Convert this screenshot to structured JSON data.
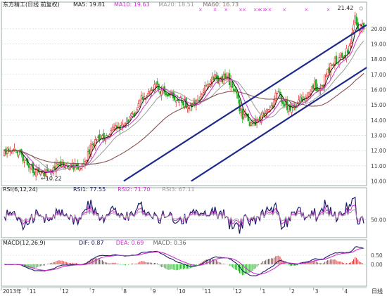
{
  "chart_data": [
    {
      "type": "candlestick",
      "title": "东方精工(日线 前复权)",
      "legend": [
        {
          "label": "MA5:",
          "value": "19.81",
          "color": "#1a1a1a"
        },
        {
          "label": "MA10:",
          "value": "19.63",
          "color": "#cc33cc"
        },
        {
          "label": "MA20:",
          "value": "18.51",
          "color": "#9a9a9a"
        },
        {
          "label": "MA60:",
          "value": "16.73",
          "color": "#8a6a6a"
        }
      ],
      "ylim": [
        9.7,
        21.75
      ],
      "yticks": [
        "20.00",
        "19.00",
        "18.00",
        "17.00",
        "16.00",
        "15.00",
        "14.00",
        "13.00",
        "12.00",
        "11.00",
        "10.00"
      ],
      "grid": true,
      "annotations": [
        {
          "text": "21.42",
          "kind": "high",
          "x": 0.968,
          "value": 21.42
        },
        {
          "text": "←10.22",
          "kind": "low",
          "x": 0.108,
          "value": 10.22
        }
      ],
      "trend_lines": [
        {
          "from": {
            "x": 0.335,
            "y": 10.0
          },
          "to": {
            "x": 1.0,
            "y": 20.25
          }
        },
        {
          "from": {
            "x": 0.52,
            "y": 10.0
          },
          "to": {
            "x": 1.0,
            "y": 17.45
          }
        }
      ],
      "path": [
        [
          0.0,
          11.8
        ],
        [
          0.03,
          12.3
        ],
        [
          0.05,
          11.5
        ],
        [
          0.07,
          11.0
        ],
        [
          0.1,
          10.35
        ],
        [
          0.13,
          10.8
        ],
        [
          0.16,
          11.2
        ],
        [
          0.19,
          11.0
        ],
        [
          0.21,
          10.9
        ],
        [
          0.225,
          11.3
        ],
        [
          0.245,
          12.4
        ],
        [
          0.26,
          12.8
        ],
        [
          0.28,
          13.0
        ],
        [
          0.3,
          13.4
        ],
        [
          0.32,
          13.6
        ],
        [
          0.34,
          13.9
        ],
        [
          0.36,
          14.4
        ],
        [
          0.38,
          15.4
        ],
        [
          0.4,
          15.6
        ],
        [
          0.42,
          16.2
        ],
        [
          0.44,
          15.9
        ],
        [
          0.46,
          15.6
        ],
        [
          0.48,
          15.3
        ],
        [
          0.5,
          15.2
        ],
        [
          0.52,
          14.8
        ],
        [
          0.54,
          15.1
        ],
        [
          0.56,
          16.3
        ],
        [
          0.58,
          16.9
        ],
        [
          0.6,
          16.6
        ],
        [
          0.62,
          16.8
        ],
        [
          0.64,
          16.1
        ],
        [
          0.66,
          14.4
        ],
        [
          0.68,
          13.9
        ],
        [
          0.7,
          13.8
        ],
        [
          0.72,
          14.3
        ],
        [
          0.74,
          14.7
        ],
        [
          0.76,
          15.8
        ],
        [
          0.78,
          15.0
        ],
        [
          0.8,
          14.8
        ],
        [
          0.82,
          15.2
        ],
        [
          0.84,
          15.6
        ],
        [
          0.86,
          16.3
        ],
        [
          0.88,
          16.0
        ],
        [
          0.9,
          17.2
        ],
        [
          0.92,
          17.9
        ],
        [
          0.94,
          18.0
        ],
        [
          0.955,
          18.6
        ],
        [
          0.965,
          19.2
        ],
        [
          0.975,
          21.0
        ],
        [
          0.985,
          19.8
        ],
        [
          0.995,
          20.1
        ]
      ],
      "ma_series": [
        {
          "name": "MA5",
          "color": "#1a1a1a",
          "lag": 4,
          "width": 1.0
        },
        {
          "name": "MA10",
          "color": "#cc33cc",
          "lag": 9,
          "width": 1.0
        },
        {
          "name": "MA20",
          "color": "#9a9a9a",
          "lag": 18,
          "width": 1.0
        },
        {
          "name": "MA60",
          "color": "#8a5050",
          "lag": 55,
          "width": 1.1
        }
      ],
      "top_markers": [
        0.545,
        0.585,
        0.615,
        0.655,
        0.665,
        0.695,
        0.735,
        0.775,
        0.835,
        0.895
      ],
      "top_markers_extra": [
        0.705,
        0.71,
        0.72,
        0.725
      ],
      "top_circles": [
        0.985
      ]
    },
    {
      "type": "line",
      "title": "RSI(6,12,24)",
      "legend": [
        {
          "label": "RSI1:",
          "value": "77.55",
          "color": "#1a1a66"
        },
        {
          "label": "RSI2:",
          "value": "71.70",
          "color": "#cc33cc"
        },
        {
          "label": "RSI3:",
          "value": "67.11",
          "color": "#9a9a9a"
        }
      ],
      "ylim": [
        22,
        100
      ],
      "yticks": [
        "50.00"
      ],
      "grid": true,
      "series": [
        {
          "name": "RSI1",
          "color": "#1a1a66",
          "swing": 1.0,
          "width": 1.2
        },
        {
          "name": "RSI2",
          "color": "#cc33cc",
          "swing": 0.6,
          "width": 1.0
        },
        {
          "name": "RSI3",
          "color": "#a0a0a0",
          "swing": 0.35,
          "width": 1.0
        }
      ]
    },
    {
      "type": "bar+line",
      "title": "MACD(12,26,9)",
      "legend": [
        {
          "label": "DIF:",
          "value": "0.87",
          "color": "#1a1a66"
        },
        {
          "label": "DEA:",
          "value": "0.69",
          "color": "#cc33cc"
        },
        {
          "label": "MACD:",
          "value": "0.36",
          "color": "#666666"
        }
      ],
      "ylim": [
        -1.2,
        1.35
      ],
      "yticks": [
        "0.50",
        "0.00"
      ],
      "grid": true,
      "bar_colors": {
        "positive": "#dd2222",
        "negative": "#22aa22"
      },
      "line_colors": {
        "dif": "#1a1a66",
        "dea": "#cc33cc"
      }
    }
  ],
  "x_axis": {
    "labels": [
      {
        "text": "2013年",
        "x": 0.0
      },
      {
        "text": "11",
        "x": 0.073
      },
      {
        "text": "12",
        "x": 0.162
      },
      {
        "text": "7",
        "x": 0.243
      },
      {
        "text": "8",
        "x": 0.33
      },
      {
        "text": "9",
        "x": 0.41
      },
      {
        "text": "10",
        "x": 0.482
      },
      {
        "text": "11",
        "x": 0.552
      },
      {
        "text": "12",
        "x": 0.636
      },
      {
        "text": "1",
        "x": 0.71
      },
      {
        "text": "2",
        "x": 0.79
      },
      {
        "text": "3",
        "x": 0.855
      },
      {
        "text": "4",
        "x": 0.935
      }
    ],
    "right_label": "日线"
  }
}
